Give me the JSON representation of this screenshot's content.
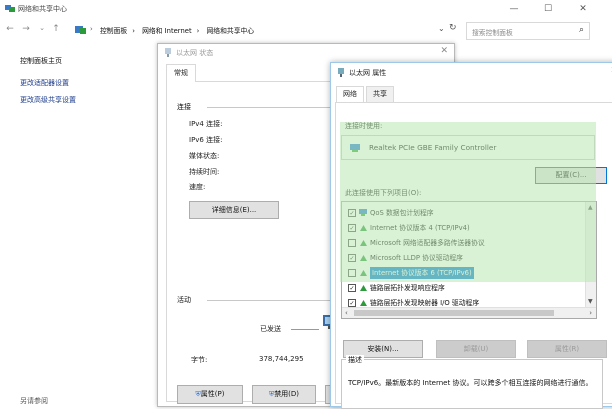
{
  "window": {
    "title": "网络和共享中心",
    "minimize": "—",
    "maximize": "☐",
    "close": "✕"
  },
  "nav": {
    "back": "←",
    "forward": "→",
    "up": "↑",
    "chevron": "⌄",
    "refresh": "↻"
  },
  "breadcrumbs": [
    "控制面板",
    "网络和 Internet",
    "网络和共享中心"
  ],
  "breadcrumb_sep": "›",
  "search": {
    "placeholder": "搜索控制面板"
  },
  "sidebar": {
    "items": [
      {
        "label": "控制面板主页"
      },
      {
        "label": "更改适配器设置"
      },
      {
        "label": "更改高级共享设置"
      }
    ],
    "see_also": "另请参阅"
  },
  "status_dialog": {
    "title": "以太网 状态",
    "tab": "常规",
    "connection_group": "连接",
    "fields": [
      "IPv4 连接:",
      "IPv6 连接:",
      "媒体状态:",
      "持续时间:",
      "速度:"
    ],
    "details_button": "详细信息(E)...",
    "activity_group": "活动",
    "sent_label": "已发送",
    "bytes_label": "字节:",
    "bytes_sent": "378,744,295",
    "properties_button": "属性(P)",
    "disable_button": "禁用(D)"
  },
  "properties_dialog": {
    "title": "以太网 属性",
    "tabs": [
      "网络",
      "共享"
    ],
    "connect_using_label": "连接时使用:",
    "adapter_name": "Realtek PCIe GBE Family Controller",
    "configure_button": "配置(C)...",
    "items_label": "此连接使用下列项目(O):",
    "items": [
      {
        "label": "QoS 数据包计划程序",
        "checked": true,
        "selected": false
      },
      {
        "label": "Internet 协议版本 4 (TCP/IPv4)",
        "checked": true,
        "selected": false
      },
      {
        "label": "Microsoft 网络适配器多路传送器协议",
        "checked": false,
        "selected": false
      },
      {
        "label": "Microsoft LLDP 协议驱动程序",
        "checked": true,
        "selected": false
      },
      {
        "label": "Internet 协议版本 6 (TCP/IPv6)",
        "checked": false,
        "selected": true
      },
      {
        "label": "链路层拓扑发现响应程序",
        "checked": true,
        "selected": false
      },
      {
        "label": "链路层拓扑发现映射器 I/O 驱动程序",
        "checked": true,
        "selected": false
      }
    ],
    "install_button": "安装(N)...",
    "uninstall_button": "卸载(U)",
    "properties_button": "属性(R)",
    "description_group": "描述",
    "description": "TCP/IPv6。最新版本的 Internet 协议。可以跨多个相互连接的网络进行通信。",
    "highlight_color": "#c7ecc4",
    "select_color": "#0078d7"
  }
}
